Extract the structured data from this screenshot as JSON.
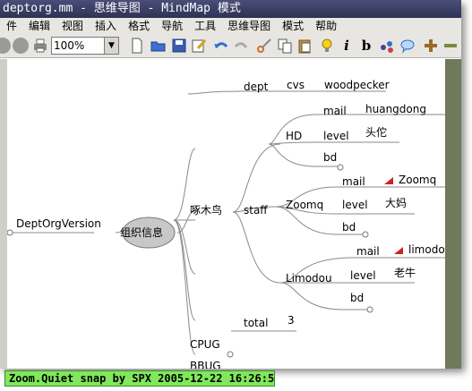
{
  "window": {
    "title": "deptorg.mm - 思维导图 - MindMap 模式"
  },
  "menu": [
    "件",
    "编辑",
    "视图",
    "插入",
    "格式",
    "导航",
    "工具",
    "思维导图",
    "模式",
    "帮助"
  ],
  "toolbar": {
    "zoom": "100%"
  },
  "map": {
    "root": "DeptOrgVersion",
    "center": "组织信息",
    "woodpecker": "啄木鸟",
    "dept": "dept",
    "cvs": "cvs",
    "cvs_value": "woodpecker",
    "staff": "staff",
    "hd": "HD",
    "hd_mail": "mail",
    "hd_mail_value": "huangdong",
    "hd_level": "level",
    "hd_level_value": "头佗",
    "hd_bd": "bd",
    "zoomq": "Zoomq",
    "zoomq_mail": "mail",
    "zoomq_mail_value": "Zoomq",
    "zoomq_level": "level",
    "zoomq_level_value": "大妈",
    "zoomq_bd": "bd",
    "limodou": "Limodou",
    "limodou_mail": "mail",
    "limodou_mail_value": "limodou",
    "limodou_level": "level",
    "limodou_level_value": "老牛",
    "limodou_bd": "bd",
    "total": "total",
    "total_value": "3",
    "cpug": "CPUG",
    "bbug": "BBUG"
  },
  "status": "Zoom.Quiet snap by SPX 2005-12-22  16:26:52",
  "colors": {
    "link_icon": "#cc2222",
    "node_fill": "#c8c8c8",
    "status_bg": "#80e85c"
  }
}
